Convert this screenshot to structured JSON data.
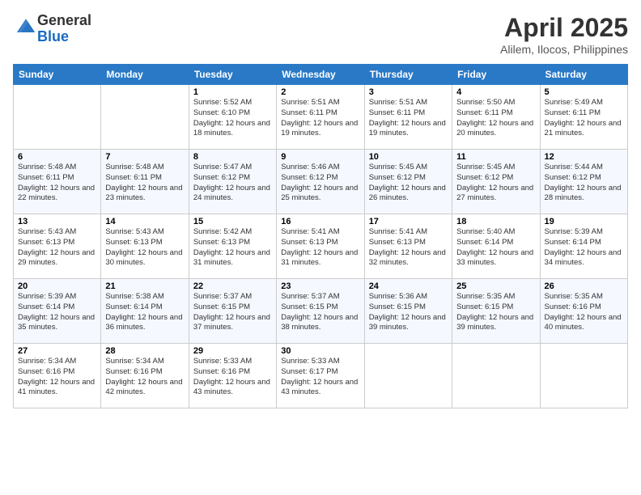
{
  "logo": {
    "general": "General",
    "blue": "Blue"
  },
  "title": "April 2025",
  "subtitle": "Alilem, Ilocos, Philippines",
  "days_of_week": [
    "Sunday",
    "Monday",
    "Tuesday",
    "Wednesday",
    "Thursday",
    "Friday",
    "Saturday"
  ],
  "weeks": [
    [
      {
        "day": "",
        "info": ""
      },
      {
        "day": "",
        "info": ""
      },
      {
        "day": "1",
        "sunrise": "Sunrise: 5:52 AM",
        "sunset": "Sunset: 6:10 PM",
        "daylight": "Daylight: 12 hours and 18 minutes."
      },
      {
        "day": "2",
        "sunrise": "Sunrise: 5:51 AM",
        "sunset": "Sunset: 6:11 PM",
        "daylight": "Daylight: 12 hours and 19 minutes."
      },
      {
        "day": "3",
        "sunrise": "Sunrise: 5:51 AM",
        "sunset": "Sunset: 6:11 PM",
        "daylight": "Daylight: 12 hours and 19 minutes."
      },
      {
        "day": "4",
        "sunrise": "Sunrise: 5:50 AM",
        "sunset": "Sunset: 6:11 PM",
        "daylight": "Daylight: 12 hours and 20 minutes."
      },
      {
        "day": "5",
        "sunrise": "Sunrise: 5:49 AM",
        "sunset": "Sunset: 6:11 PM",
        "daylight": "Daylight: 12 hours and 21 minutes."
      }
    ],
    [
      {
        "day": "6",
        "sunrise": "Sunrise: 5:48 AM",
        "sunset": "Sunset: 6:11 PM",
        "daylight": "Daylight: 12 hours and 22 minutes."
      },
      {
        "day": "7",
        "sunrise": "Sunrise: 5:48 AM",
        "sunset": "Sunset: 6:11 PM",
        "daylight": "Daylight: 12 hours and 23 minutes."
      },
      {
        "day": "8",
        "sunrise": "Sunrise: 5:47 AM",
        "sunset": "Sunset: 6:12 PM",
        "daylight": "Daylight: 12 hours and 24 minutes."
      },
      {
        "day": "9",
        "sunrise": "Sunrise: 5:46 AM",
        "sunset": "Sunset: 6:12 PM",
        "daylight": "Daylight: 12 hours and 25 minutes."
      },
      {
        "day": "10",
        "sunrise": "Sunrise: 5:45 AM",
        "sunset": "Sunset: 6:12 PM",
        "daylight": "Daylight: 12 hours and 26 minutes."
      },
      {
        "day": "11",
        "sunrise": "Sunrise: 5:45 AM",
        "sunset": "Sunset: 6:12 PM",
        "daylight": "Daylight: 12 hours and 27 minutes."
      },
      {
        "day": "12",
        "sunrise": "Sunrise: 5:44 AM",
        "sunset": "Sunset: 6:12 PM",
        "daylight": "Daylight: 12 hours and 28 minutes."
      }
    ],
    [
      {
        "day": "13",
        "sunrise": "Sunrise: 5:43 AM",
        "sunset": "Sunset: 6:13 PM",
        "daylight": "Daylight: 12 hours and 29 minutes."
      },
      {
        "day": "14",
        "sunrise": "Sunrise: 5:43 AM",
        "sunset": "Sunset: 6:13 PM",
        "daylight": "Daylight: 12 hours and 30 minutes."
      },
      {
        "day": "15",
        "sunrise": "Sunrise: 5:42 AM",
        "sunset": "Sunset: 6:13 PM",
        "daylight": "Daylight: 12 hours and 31 minutes."
      },
      {
        "day": "16",
        "sunrise": "Sunrise: 5:41 AM",
        "sunset": "Sunset: 6:13 PM",
        "daylight": "Daylight: 12 hours and 31 minutes."
      },
      {
        "day": "17",
        "sunrise": "Sunrise: 5:41 AM",
        "sunset": "Sunset: 6:13 PM",
        "daylight": "Daylight: 12 hours and 32 minutes."
      },
      {
        "day": "18",
        "sunrise": "Sunrise: 5:40 AM",
        "sunset": "Sunset: 6:14 PM",
        "daylight": "Daylight: 12 hours and 33 minutes."
      },
      {
        "day": "19",
        "sunrise": "Sunrise: 5:39 AM",
        "sunset": "Sunset: 6:14 PM",
        "daylight": "Daylight: 12 hours and 34 minutes."
      }
    ],
    [
      {
        "day": "20",
        "sunrise": "Sunrise: 5:39 AM",
        "sunset": "Sunset: 6:14 PM",
        "daylight": "Daylight: 12 hours and 35 minutes."
      },
      {
        "day": "21",
        "sunrise": "Sunrise: 5:38 AM",
        "sunset": "Sunset: 6:14 PM",
        "daylight": "Daylight: 12 hours and 36 minutes."
      },
      {
        "day": "22",
        "sunrise": "Sunrise: 5:37 AM",
        "sunset": "Sunset: 6:15 PM",
        "daylight": "Daylight: 12 hours and 37 minutes."
      },
      {
        "day": "23",
        "sunrise": "Sunrise: 5:37 AM",
        "sunset": "Sunset: 6:15 PM",
        "daylight": "Daylight: 12 hours and 38 minutes."
      },
      {
        "day": "24",
        "sunrise": "Sunrise: 5:36 AM",
        "sunset": "Sunset: 6:15 PM",
        "daylight": "Daylight: 12 hours and 39 minutes."
      },
      {
        "day": "25",
        "sunrise": "Sunrise: 5:35 AM",
        "sunset": "Sunset: 6:15 PM",
        "daylight": "Daylight: 12 hours and 39 minutes."
      },
      {
        "day": "26",
        "sunrise": "Sunrise: 5:35 AM",
        "sunset": "Sunset: 6:16 PM",
        "daylight": "Daylight: 12 hours and 40 minutes."
      }
    ],
    [
      {
        "day": "27",
        "sunrise": "Sunrise: 5:34 AM",
        "sunset": "Sunset: 6:16 PM",
        "daylight": "Daylight: 12 hours and 41 minutes."
      },
      {
        "day": "28",
        "sunrise": "Sunrise: 5:34 AM",
        "sunset": "Sunset: 6:16 PM",
        "daylight": "Daylight: 12 hours and 42 minutes."
      },
      {
        "day": "29",
        "sunrise": "Sunrise: 5:33 AM",
        "sunset": "Sunset: 6:16 PM",
        "daylight": "Daylight: 12 hours and 43 minutes."
      },
      {
        "day": "30",
        "sunrise": "Sunrise: 5:33 AM",
        "sunset": "Sunset: 6:17 PM",
        "daylight": "Daylight: 12 hours and 43 minutes."
      },
      {
        "day": "",
        "info": ""
      },
      {
        "day": "",
        "info": ""
      },
      {
        "day": "",
        "info": ""
      }
    ]
  ]
}
